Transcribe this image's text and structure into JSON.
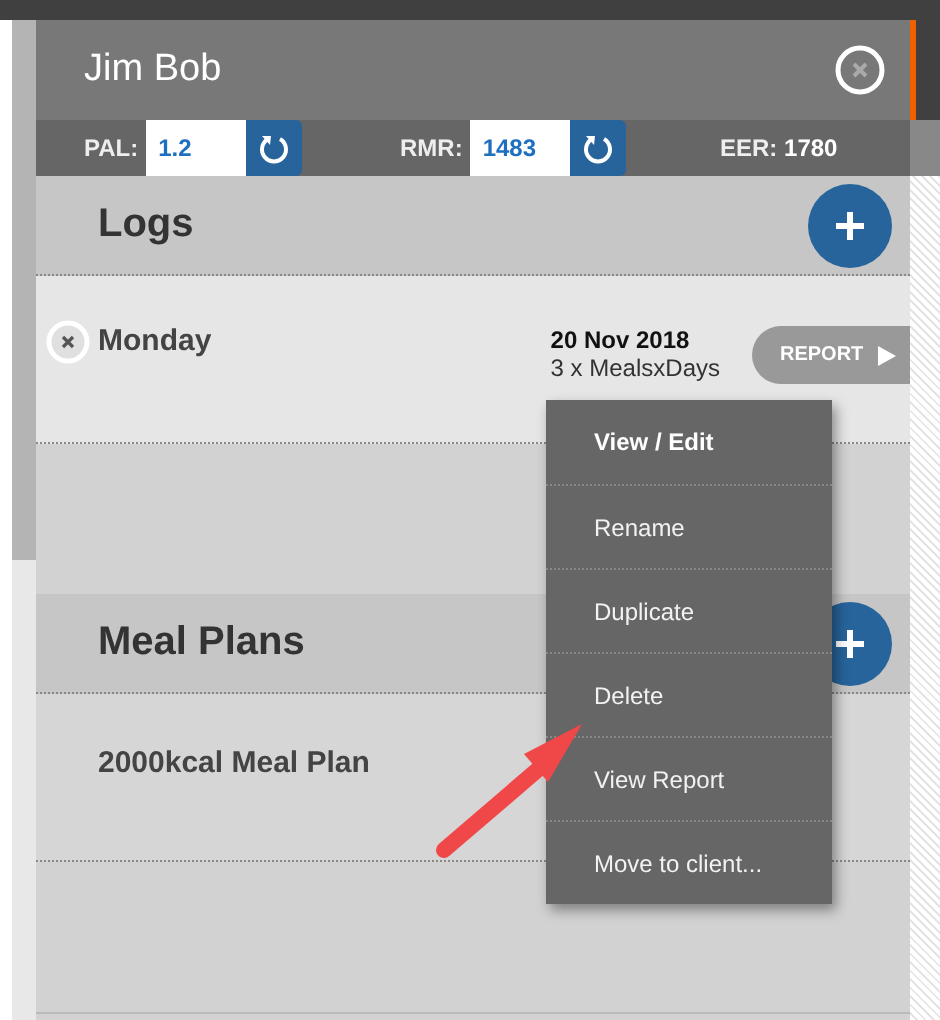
{
  "client": {
    "name": "Jim Bob"
  },
  "stats": [
    {
      "kind": "input",
      "label": "PAL:",
      "value": "1.2"
    },
    {
      "kind": "input",
      "label": "RMR:",
      "value": "1483"
    },
    {
      "kind": "readout",
      "label": "EER:",
      "value": "1780"
    }
  ],
  "sections": [
    {
      "title": "Logs",
      "items": [
        {
          "kind": "log",
          "name": "Monday",
          "date": "20 Nov 2018",
          "detail": "3 x MealsxDays",
          "button": "REPORT"
        }
      ]
    },
    {
      "title": "Meal Plans",
      "items": [
        {
          "kind": "plan",
          "name": "2000kcal Meal Plan"
        }
      ]
    }
  ],
  "context_menu": {
    "items": [
      {
        "label": "View / Edit",
        "default": true
      },
      {
        "label": "Rename",
        "default": false
      },
      {
        "label": "Duplicate",
        "default": false
      },
      {
        "label": "Delete",
        "default": false
      },
      {
        "label": "View Report",
        "default": false
      },
      {
        "label": "Move to client...",
        "default": false
      }
    ]
  }
}
